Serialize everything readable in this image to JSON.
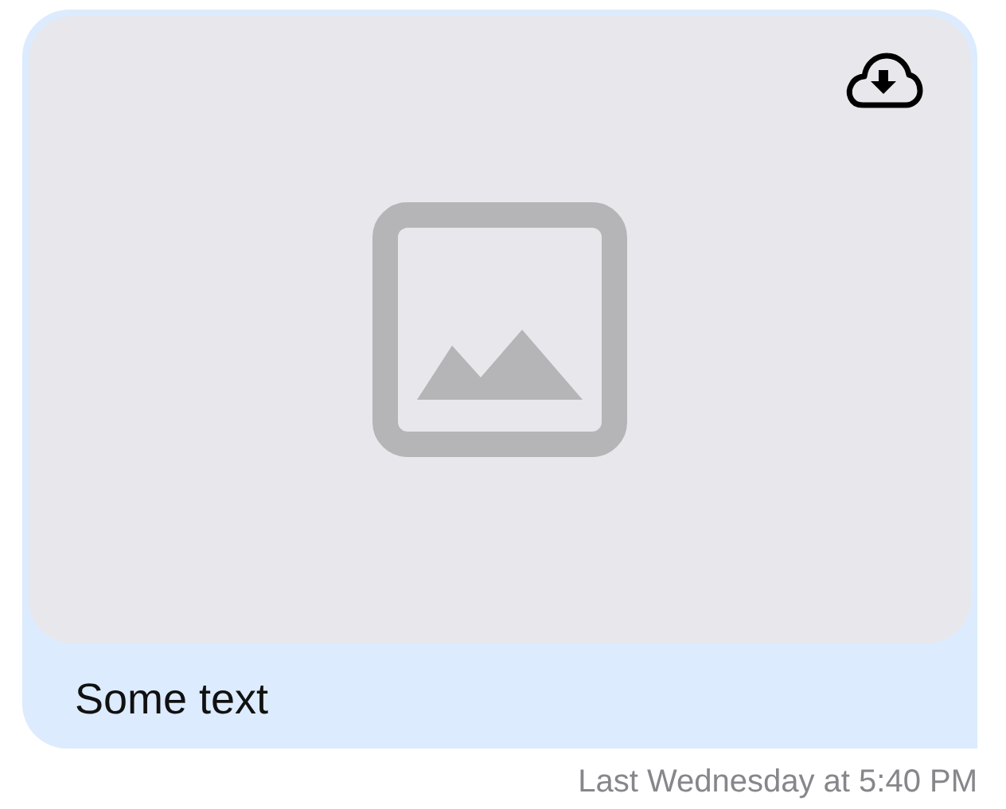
{
  "message": {
    "text": "Some text",
    "timestamp": "Last Wednesday at 5:40 PM"
  }
}
